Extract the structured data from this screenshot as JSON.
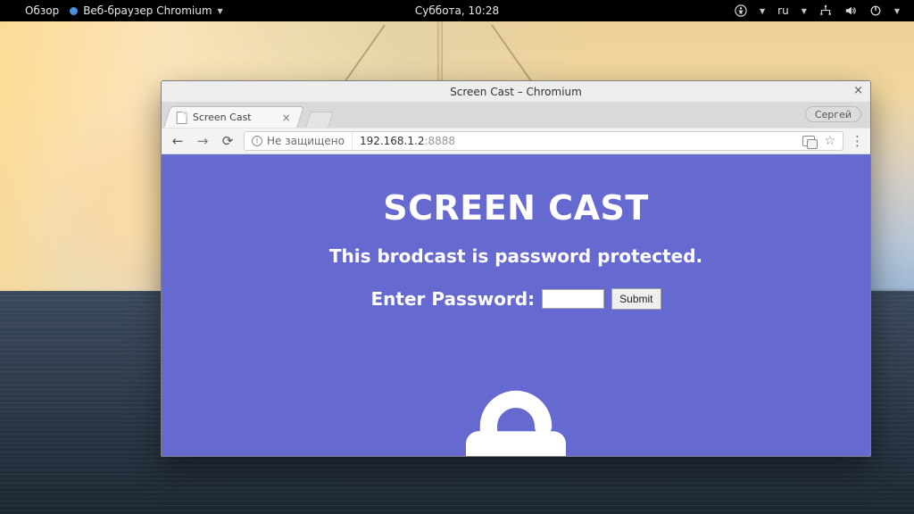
{
  "os_topbar": {
    "overview": "Обзор",
    "app_name": "Веб-браузер Chromium",
    "clock": "Суббота, 10:28",
    "lang": "ru"
  },
  "browser": {
    "window_title": "Screen Cast – Chromium",
    "user_label": "Сергей",
    "tab": {
      "title": "Screen Cast"
    },
    "security_label": "Не защищено",
    "url_host": "192.168.1.2",
    "url_port": ":8888"
  },
  "page": {
    "title": "SCREEN CAST",
    "subtitle": "This brodcast is password protected.",
    "prompt": "Enter Password:",
    "submit": "Submit",
    "password_value": ""
  }
}
